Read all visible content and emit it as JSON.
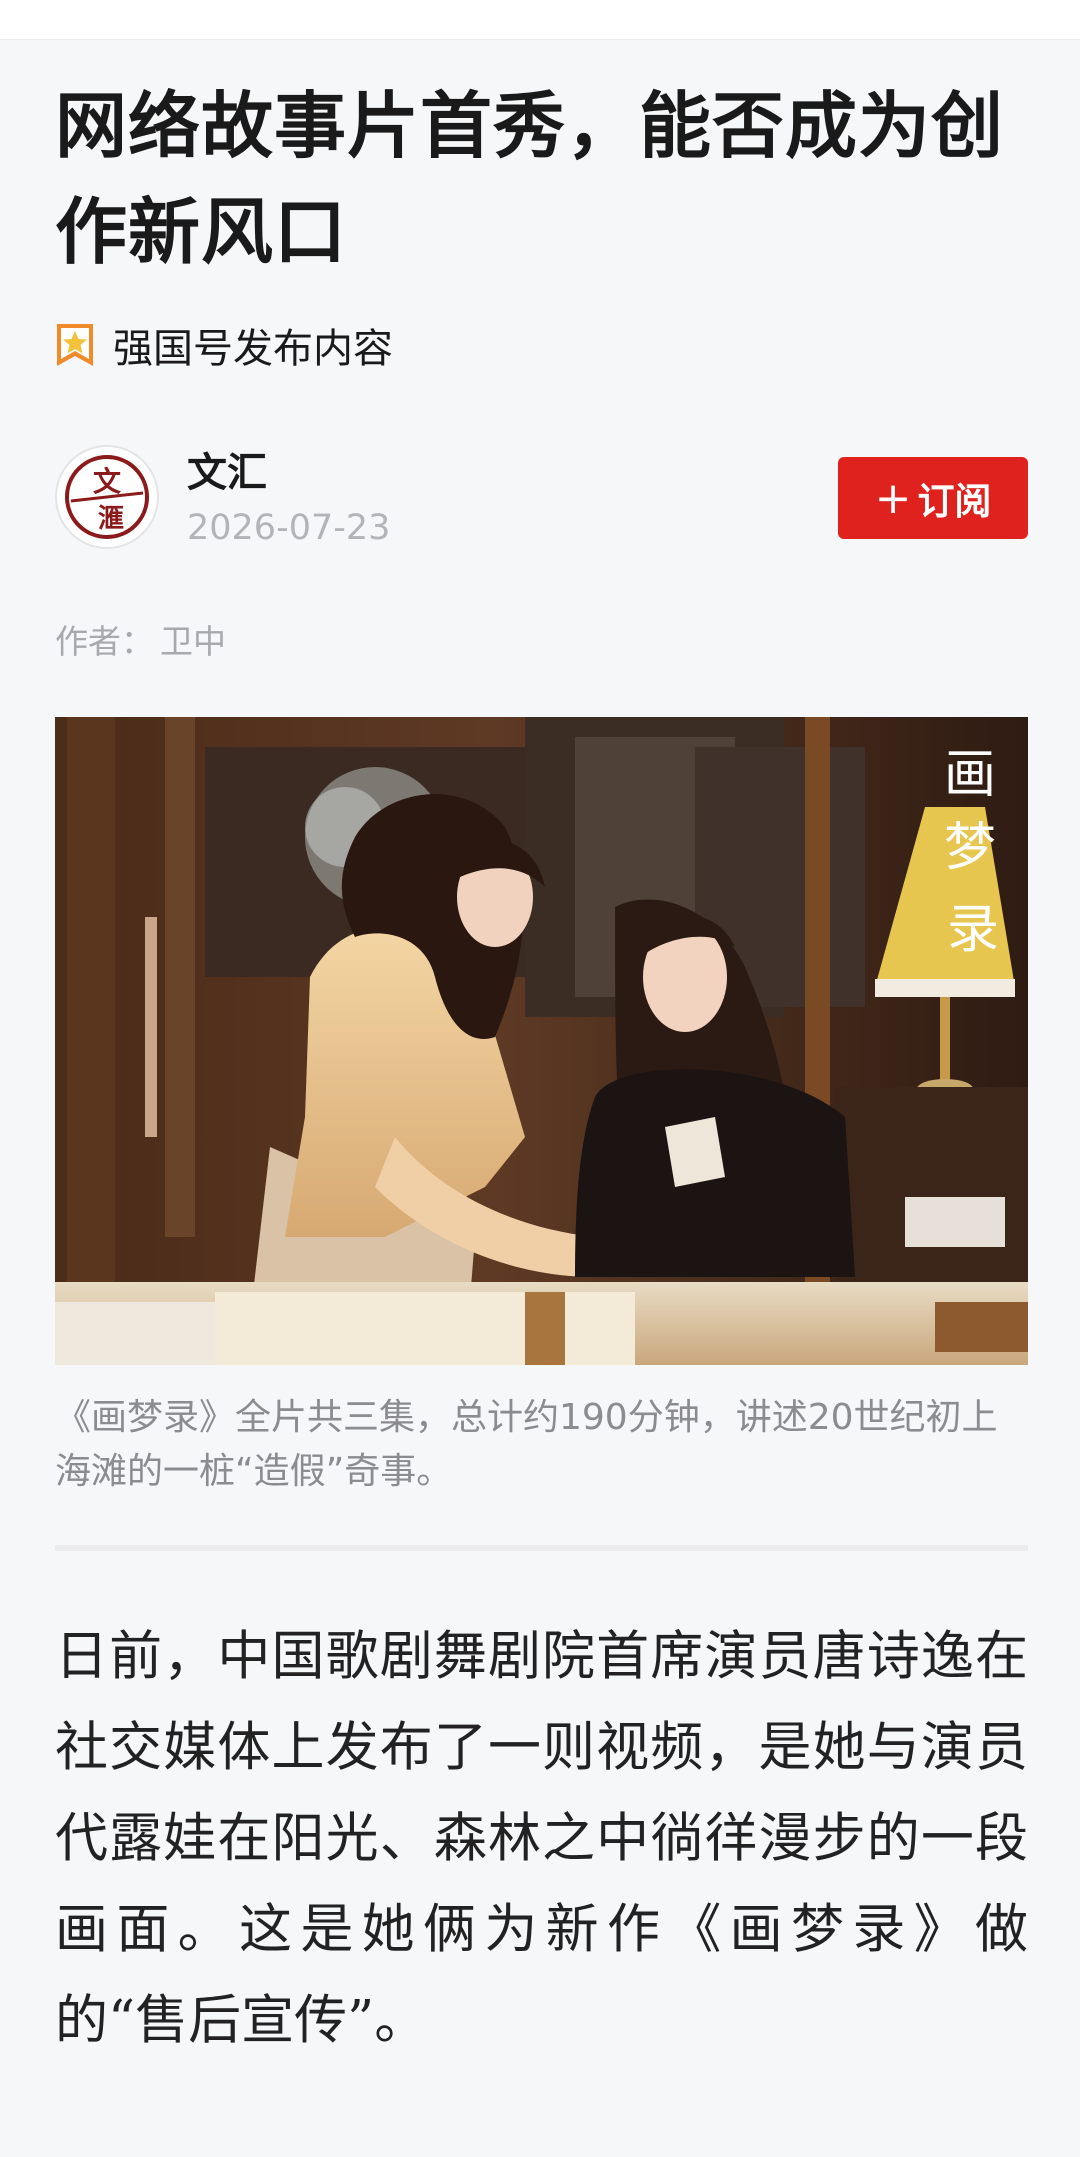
{
  "article": {
    "title": "网络故事片首秀，能否成为创作新风口",
    "source_badge": "强国号发布内容",
    "publisher": {
      "name": "文汇",
      "date": "2026-07-23",
      "avatar_text_top": "文",
      "avatar_text_bottom": "滙",
      "subscribe_label": "订阅",
      "subscribe_plus": "+"
    },
    "byline_label": "作者：",
    "byline_author": "卫中",
    "image": {
      "overlay_text": [
        "画",
        "梦",
        "录"
      ]
    },
    "caption": "《画梦录》全片共三集，总计约190分钟，讲述20世纪初上海滩的一桩“造假”奇事。",
    "body": "日前，中国歌剧舞剧院首席演员唐诗逸在社交媒体上发布了一则视频，是她与演员代露娃在阳光、森林之中徜徉漫步的一段画面。这是她俩为新作《画梦录》做的“售后宣传”。"
  },
  "colors": {
    "accent": "#e0221e",
    "background": "#f6f7f9",
    "muted": "#a8a8ad"
  }
}
